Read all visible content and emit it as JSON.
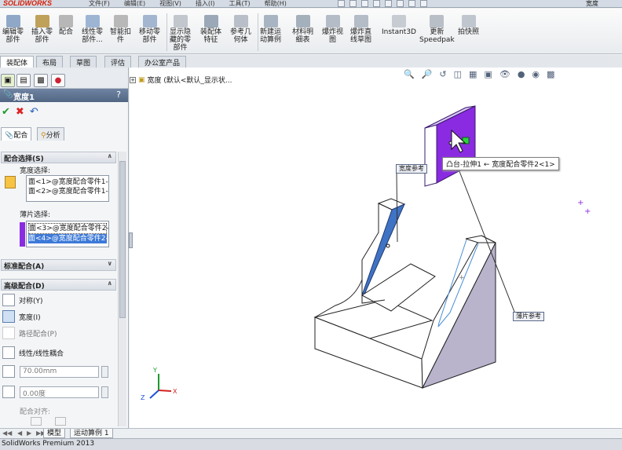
{
  "titlebar": {
    "app_name": "SOLIDWORKS",
    "menu": [
      "文件(F)",
      "编辑(E)",
      "视图(V)",
      "插入(I)",
      "工具(T)",
      "帮助(H)"
    ],
    "user": "宽度"
  },
  "command_manager": {
    "buttons": [
      {
        "label": "编辑零\n部件",
        "icon": "edit-component-icon"
      },
      {
        "label": "插入零\n部件",
        "icon": "insert-component-icon"
      },
      {
        "label": "配合",
        "icon": "mate-icon"
      },
      {
        "label": "线性零\n部件...",
        "icon": "linear-pattern-icon"
      },
      {
        "label": "智能扣\n件",
        "icon": "smart-fastener-icon"
      },
      {
        "label": "移动零\n部件",
        "icon": "move-component-icon"
      },
      {
        "label": "显示隐\n藏的零\n部件",
        "icon": "show-hidden-icon"
      },
      {
        "label": "装配体\n特征",
        "icon": "assembly-feature-icon"
      },
      {
        "label": "参考几\n何体",
        "icon": "reference-geometry-icon"
      },
      {
        "label": "新建运\n动算例",
        "icon": "motion-study-icon"
      },
      {
        "label": "材料明\n细表",
        "icon": "bom-icon"
      },
      {
        "label": "爆炸视\n图",
        "icon": "exploded-view-icon"
      },
      {
        "label": "爆炸直\n线草图",
        "icon": "explode-line-icon"
      },
      {
        "label": "Instant3D",
        "icon": "instant3d-icon"
      },
      {
        "label": "更新\nSpeedpak",
        "icon": "speedpak-icon"
      },
      {
        "label": "拍快照",
        "icon": "snapshot-icon"
      }
    ]
  },
  "tabs": [
    "装配体",
    "布局",
    "草图",
    "评估",
    "办公室产品"
  ],
  "property_manager": {
    "title": "宽度1",
    "help": "?",
    "subtabs": [
      "配合",
      "分析"
    ],
    "mate_selection": {
      "header": "配合选择(S)",
      "width_label": "宽度选择:",
      "width_items": [
        "面<1>@宽度配合零件1-",
        "面<2>@宽度配合零件1-"
      ],
      "tab_label": "薄片选择:",
      "tab_items": [
        "面<3>@宽度配合零件2-",
        "面<4>@宽度配合零件2-"
      ]
    },
    "standard_header": "标准配合(A)",
    "advanced": {
      "header": "高级配合(D)",
      "options": [
        "对称(Y)",
        "宽度(I)",
        "路径配合(P)",
        "线性/线性耦合"
      ],
      "distance_value": "70.00mm",
      "angle_value": "0.00度",
      "alignment_label": "配合对齐:"
    }
  },
  "graphics": {
    "tree_label": "宽度 (默认<默认_显示状...",
    "callout_width": "宽度参考",
    "callout_tab": "薄片参考",
    "tooltip": "凸台-拉伸1 ← 宽度配合零件2<1>",
    "triad": {
      "x": "X",
      "y": "Y",
      "z": "Z"
    }
  },
  "sheet_tabs": [
    "模型",
    "运动算例 1"
  ],
  "status_text": "SolidWorks Premium 2013",
  "colors": {
    "purple": "#8a2be2",
    "blue_face": "#3f73c4",
    "header_blue": "#5d7292"
  }
}
